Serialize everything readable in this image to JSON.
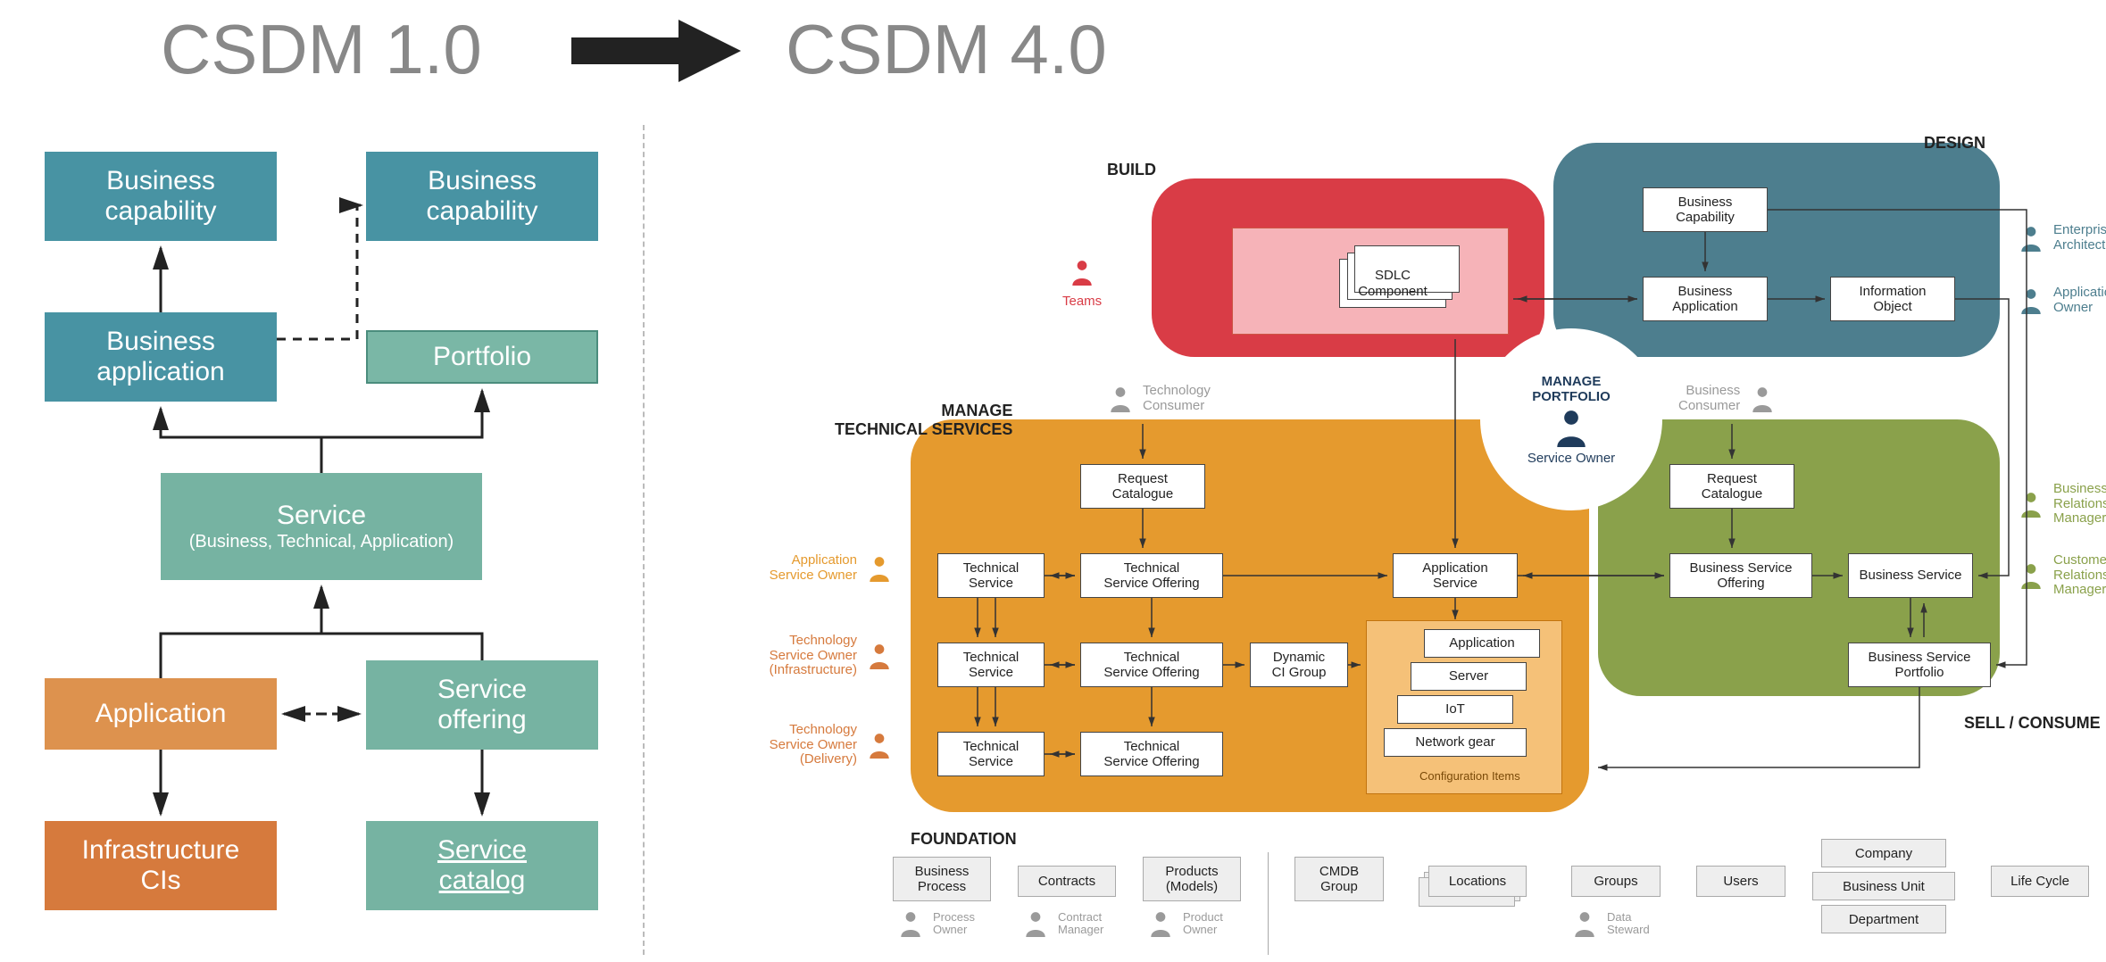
{
  "titles": {
    "left": "CSDM 1.0",
    "right": "CSDM 4.0"
  },
  "csdm1": {
    "biz_cap1": "Business\ncapability",
    "biz_cap2": "Business\ncapability",
    "biz_app": "Business\napplication",
    "portfolio": "Portfolio",
    "service": "Service",
    "service_sub": "(Business, Technical, Application)",
    "application": "Application",
    "svc_offering": "Service\noffering",
    "infra_cis": "Infrastructure\nCIs",
    "svc_catalog": "Service\ncatalog"
  },
  "domains": {
    "build": "BUILD",
    "design": "DESIGN",
    "mts": "MANAGE\nTECHNICAL SERVICES",
    "sell": "SELL / CONSUME",
    "foundation": "FOUNDATION"
  },
  "mp": {
    "label_top": "MANAGE",
    "label_bottom": "PORTFOLIO",
    "role": "Service Owner"
  },
  "build": {
    "sdlc": "SDLC\nComponent"
  },
  "design": {
    "biz_cap": "Business\nCapability",
    "biz_app": "Business\nApplication",
    "info_obj": "Information\nObject"
  },
  "mts": {
    "req_cat": "Request\nCatalogue",
    "tech_svc": "Technical\nService",
    "tech_svc_off": "Technical\nService Offering",
    "app_svc": "Application\nService",
    "dyn_ci": "Dynamic\nCI Group",
    "ci_app": "Application",
    "ci_server": "Server",
    "ci_iot": "IoT",
    "ci_net": "Network gear",
    "ci_label": "Configuration Items"
  },
  "sell": {
    "req_cat": "Request\nCatalogue",
    "biz_svc_off": "Business Service\nOffering",
    "biz_svc": "Business Service",
    "biz_svc_port": "Business Service\nPortfolio"
  },
  "foundation": {
    "biz_proc": "Business\nProcess",
    "contracts": "Contracts",
    "products": "Products\n(Models)",
    "cmdb": "CMDB\nGroup",
    "locations": "Locations",
    "groups": "Groups",
    "users": "Users",
    "company": "Company",
    "biz_unit": "Business Unit",
    "dept": "Department",
    "life_cycle": "Life Cycle"
  },
  "personas": {
    "teams": "Teams",
    "tech_consumer": "Technology\nConsumer",
    "app_svc_owner": "Application\nService Owner",
    "tech_svc_owner_infra": "Technology\nService Owner\n(Infrastructure)",
    "tech_svc_owner_delivery": "Technology\nService Owner\n(Delivery)",
    "ent_arch": "Enterprise\nArchitect",
    "app_owner": "Application\nOwner",
    "biz_consumer": "Business\nConsumer",
    "brm": "Business\nRelationship\nManager",
    "crm": "Customer\nRelationship\nManager",
    "proc_owner": "Process\nOwner",
    "contract_mgr": "Contract\nManager",
    "prod_owner": "Product\nOwner",
    "data_steward": "Data\nSteward"
  },
  "colors": {
    "teams": "#d93c46",
    "mts_persona": "#e59a2e",
    "design_persona": "#4d7e8e",
    "sell_persona": "#8aa14b",
    "gray_persona": "#9a9a9a",
    "service_owner": "#1f3b5b"
  }
}
